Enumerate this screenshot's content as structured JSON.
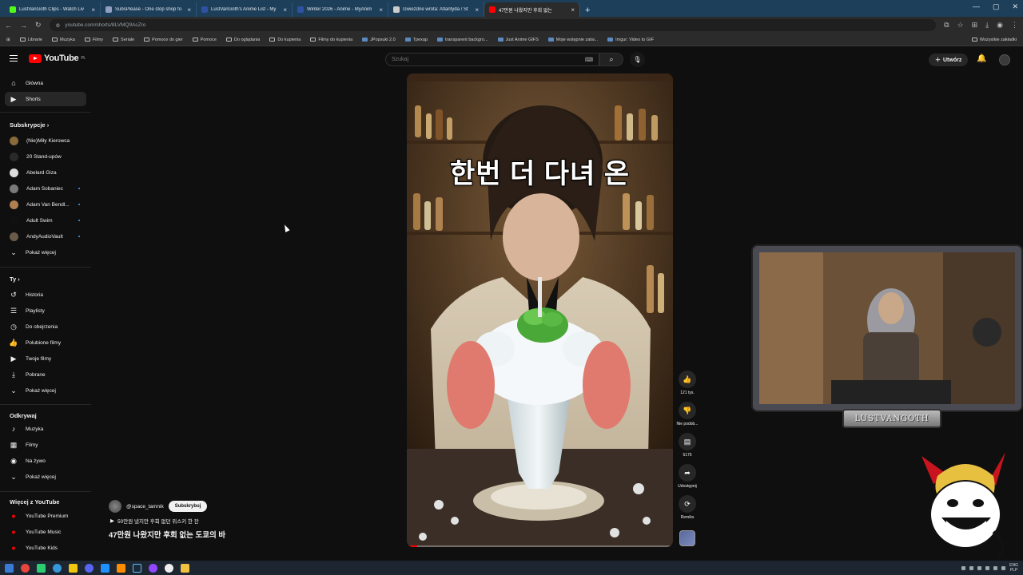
{
  "browser": {
    "tabs": [
      {
        "title": "LustVanGoth Clips - Watch Liv",
        "color": "#53fc18",
        "active": false
      },
      {
        "title": "SubsPlease - One stop shop fo",
        "color": "#8fa0c0",
        "active": false
      },
      {
        "title": "LustVanGoth's Anime List - My",
        "color": "#2e51a2",
        "active": false
      },
      {
        "title": "Winter 2026 - Anime - MyAnim",
        "color": "#2e51a2",
        "active": false
      },
      {
        "title": "Gwiezdne wrota: Atlantyda / St",
        "color": "#cccccc",
        "active": false
      },
      {
        "title": "47만원 나왔지만 후회 없는",
        "color": "#ff0000",
        "active": true
      }
    ],
    "url": "youtube.com/shorts/8LVMQ9AcZro",
    "bookmarks": [
      {
        "label": "Librarie",
        "folder": true
      },
      {
        "label": "Muzyka",
        "folder": true
      },
      {
        "label": "Filmy",
        "folder": true
      },
      {
        "label": "Seriale",
        "folder": true
      },
      {
        "label": "Pomoce do gier",
        "folder": true
      },
      {
        "label": "Pomoce",
        "folder": true
      },
      {
        "label": "Do oglądania",
        "folder": true
      },
      {
        "label": "Do kupienia",
        "folder": true
      },
      {
        "label": "Filmy do kupienia",
        "folder": true
      },
      {
        "label": "JPopsuki 2.0",
        "folder": false
      },
      {
        "label": "Tpexap",
        "folder": false
      },
      {
        "label": "transparent backgro...",
        "folder": false
      },
      {
        "label": "Just Anime GIFS",
        "folder": false
      },
      {
        "label": "Moje wstępnie zatw...",
        "folder": false
      },
      {
        "label": "Imgur: Video to GIF",
        "folder": false
      }
    ],
    "bookmarks_right": "Wszystkie zakładki"
  },
  "yt": {
    "logo_text": "YouTube",
    "logo_region": "PL",
    "search_placeholder": "Szukaj",
    "create_label": "Utwórz"
  },
  "sidebar": {
    "main": [
      {
        "label": "Główna",
        "icon": "home-icon",
        "glyph": "⌂"
      },
      {
        "label": "Shorts",
        "icon": "shorts-icon",
        "glyph": "▶"
      }
    ],
    "subs_header": "Subskrypcje",
    "subs": [
      {
        "label": "(Nie)Miły Kierowca",
        "color": "#8a6a3a",
        "dot": false
      },
      {
        "label": "20 Stand-upów",
        "color": "#2a2a2a",
        "dot": false
      },
      {
        "label": "Abelard Giza",
        "color": "#dddddd",
        "dot": false
      },
      {
        "label": "Adam Sobaniec",
        "color": "#7a7a7a",
        "dot": true
      },
      {
        "label": "Adam Van Bendl...",
        "color": "#b08050",
        "dot": true
      },
      {
        "label": "Adult Swim",
        "color": "#111111",
        "dot": true
      },
      {
        "label": "AndyAudioVault",
        "color": "#6a5a4a",
        "dot": true
      }
    ],
    "subs_more": "Pokaż więcej",
    "you_header": "Ty",
    "you": [
      {
        "label": "Historia",
        "icon": "history-icon",
        "glyph": "↺"
      },
      {
        "label": "Playlisty",
        "icon": "playlist-icon",
        "glyph": "☰"
      },
      {
        "label": "Do obejrzenia",
        "icon": "watch-later-icon",
        "glyph": "◷"
      },
      {
        "label": "Polubione filmy",
        "icon": "like-icon",
        "glyph": "👍"
      },
      {
        "label": "Twoje filmy",
        "icon": "your-videos-icon",
        "glyph": "▶"
      },
      {
        "label": "Pobrane",
        "icon": "download-icon",
        "glyph": "⤓"
      }
    ],
    "you_more": "Pokaż więcej",
    "explore_header": "Odkrywaj",
    "explore": [
      {
        "label": "Muzyka",
        "icon": "music-icon",
        "glyph": "♪"
      },
      {
        "label": "Filmy",
        "icon": "film-icon",
        "glyph": "▦"
      },
      {
        "label": "Na żywo",
        "icon": "live-icon",
        "glyph": "◉"
      }
    ],
    "explore_more": "Pokaż więcej",
    "more_header": "Więcej z YouTube",
    "more": [
      {
        "label": "YouTube Premium"
      },
      {
        "label": "YouTube Music"
      },
      {
        "label": "YouTube Kids"
      }
    ]
  },
  "video": {
    "caption": "한번 더 다녀 온",
    "progress": 0.04
  },
  "actions": {
    "likes": "121 tys.",
    "dislike_label": "Nie podob...",
    "comments": "5175",
    "share_label": "Udostępnij",
    "remix_label": "Remiks"
  },
  "channel": {
    "name": "@space_tamnik",
    "subscribe_label": "Subskrybuj",
    "music": "50만원 냈지만 후회 없던 위스키 한 잔",
    "title": "47만원 나왔지만 후회 없는 도쿄의 바"
  },
  "overlay": {
    "streamer_name": "LUSTVANGOTH"
  },
  "taskbar": {
    "lang": "ENG",
    "lang2": "PLP"
  }
}
